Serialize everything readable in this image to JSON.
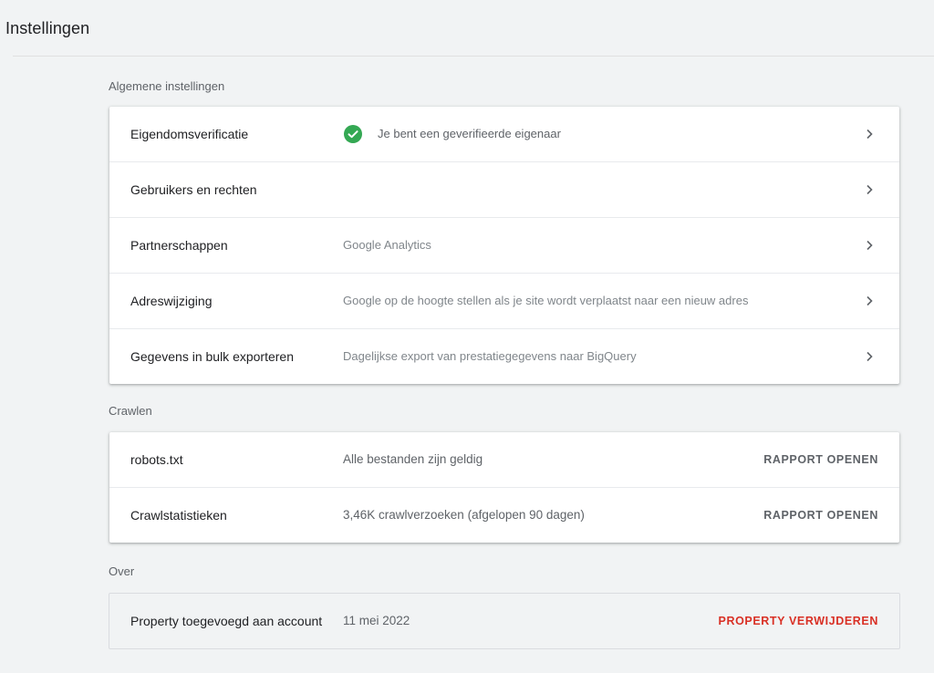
{
  "page": {
    "title": "Instellingen"
  },
  "general": {
    "section_label": "Algemene instellingen",
    "rows": [
      {
        "label": "Eigendomsverificatie",
        "description": "Je bent een geverifieerde eigenaar",
        "icon": "check-circle-icon",
        "icon_color": "#34a853"
      },
      {
        "label": "Gebruikers en rechten",
        "description": ""
      },
      {
        "label": "Partnerschappen",
        "description": "Google Analytics"
      },
      {
        "label": "Adreswijziging",
        "description": "Google op de hoogte stellen als je site wordt verplaatst naar een nieuw adres"
      },
      {
        "label": "Gegevens in bulk exporteren",
        "description": "Dagelijkse export van prestatiegegevens naar BigQuery"
      }
    ]
  },
  "crawl": {
    "section_label": "Crawlen",
    "rows": [
      {
        "label": "robots.txt",
        "description": "Alle bestanden zijn geldig",
        "action": "RAPPORT OPENEN"
      },
      {
        "label": "Crawlstatistieken",
        "description": "3,46K crawlverzoeken (afgelopen 90 dagen)",
        "action": "RAPPORT OPENEN"
      }
    ]
  },
  "about": {
    "section_label": "Over",
    "row": {
      "label": "Property toegevoegd aan account",
      "value": "11 mei 2022",
      "action": "PROPERTY VERWIJDEREN",
      "action_color": "#d93025"
    }
  }
}
